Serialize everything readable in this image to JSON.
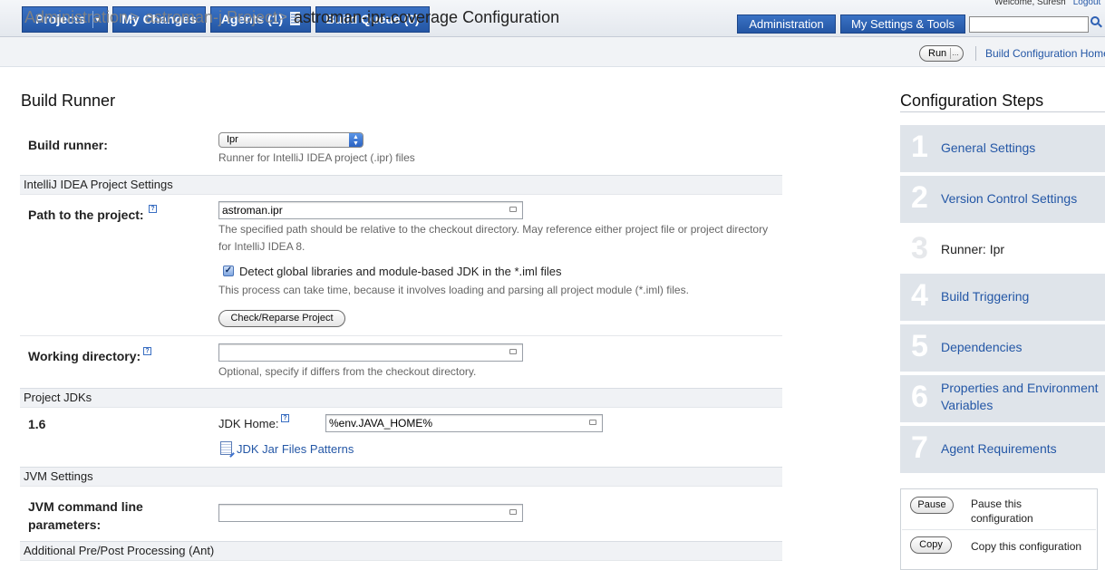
{
  "nav": {
    "projects": "Projects",
    "my_changes": "My Changes",
    "agents": "Agents (1)",
    "build_queue": "Build Queue (0)",
    "administration": "Administration",
    "my_settings": "My Settings & Tools",
    "welcome": "Welcome, Suresh",
    "logout": "Logout",
    "search_value": ""
  },
  "breadcrumb": {
    "items": [
      "Administration",
      "astroman-j Project",
      "astroman-ipr-coverage Configuration"
    ],
    "separator": ">",
    "run_label": "Run",
    "run_more": "...",
    "home_link": "Build Configuration Home"
  },
  "main": {
    "title": "Build Runner",
    "build_runner_label": "Build runner:",
    "build_runner_value": "Ipr",
    "build_runner_note": "Runner for IntelliJ IDEA project (.ipr) files",
    "idea_section": "IntelliJ IDEA Project Settings",
    "path_label": "Path to the project:",
    "path_value": "astroman.ipr",
    "path_note_1": "The specified path should be relative to the checkout directory. May reference either project file or project directory",
    "path_note_2": "for IntelliJ IDEA 8.",
    "detect_label": "Detect global libraries and module-based JDK in the *.iml files",
    "detect_checked": "✓",
    "detect_note": "This process can take time, because it involves loading and parsing all project module (*.iml) files.",
    "check_button": "Check/Reparse Project",
    "workdir_label": "Working directory:",
    "workdir_value": "",
    "workdir_note": "Optional, specify if differs from the checkout directory.",
    "jdks_section": "Project JDKs",
    "jdk_version": "1.6",
    "jdk_home_label": "JDK Home:",
    "jdk_home_value": "%env.JAVA_HOME%",
    "jdk_jar_link": "JDK Jar Files Patterns",
    "jvm_section": "JVM Settings",
    "jvm_label_1": "JVM command line",
    "jvm_label_2": "parameters:",
    "jvm_value": "",
    "ant_section": "Additional Pre/Post Processing (Ant)",
    "help_glyph": "?"
  },
  "steps": {
    "title": "Configuration Steps",
    "items": [
      {
        "num": "1",
        "label": "General Settings"
      },
      {
        "num": "2",
        "label": "Version Control Settings"
      },
      {
        "num": "3",
        "label": "Runner: Ipr"
      },
      {
        "num": "4",
        "label": "Build Triggering"
      },
      {
        "num": "5",
        "label": "Dependencies"
      },
      {
        "num": "6",
        "label_1": "Properties and Environment",
        "label_2": "Variables"
      },
      {
        "num": "7",
        "label": "Agent Requirements"
      }
    ]
  },
  "actions": {
    "pause_button": "Pause",
    "pause_text_1": "Pause this",
    "pause_text_2": "configuration",
    "copy_button": "Copy",
    "copy_text": "Copy this configuration"
  },
  "icons": {
    "agents": "agents-icon",
    "search": "search-icon",
    "help": "help-icon",
    "doc": "document-edit-icon",
    "dropdown": "chevron-down-icon"
  },
  "colors": {
    "nav_blue": "#2c5fb3",
    "link_blue": "#2457a6",
    "step_bg": "#dfe4ea"
  }
}
